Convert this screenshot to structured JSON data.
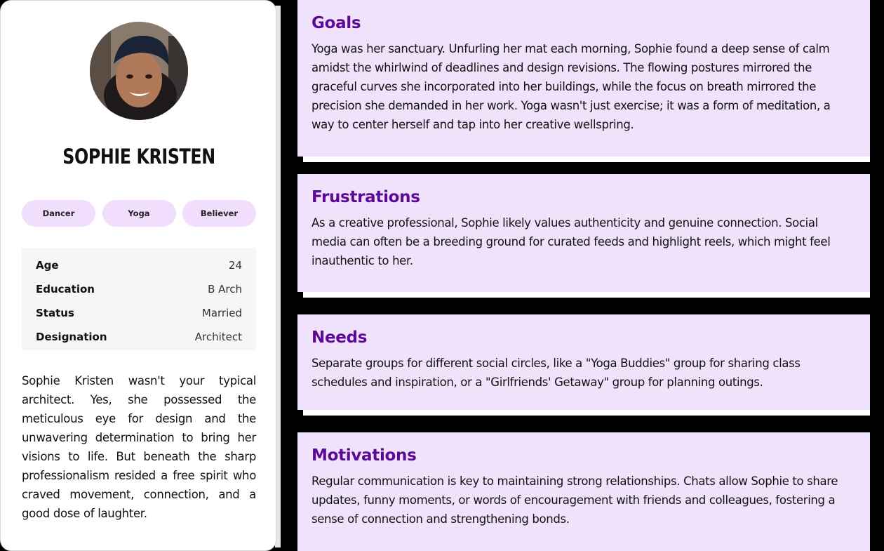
{
  "profile": {
    "name": "SOPHIE KRISTEN",
    "avatar": "profile-photo",
    "tags": [
      "Dancer",
      "Yoga",
      "Believer"
    ],
    "details": [
      {
        "label": "Age",
        "value": "24"
      },
      {
        "label": "Education",
        "value": "B Arch"
      },
      {
        "label": "Status",
        "value": "Married"
      },
      {
        "label": "Designation",
        "value": "Architect"
      }
    ],
    "bio": "Sophie Kristen wasn't your typical architect. Yes, she possessed the meticulous eye for design and the unwavering determination to bring her visions to life. But beneath the sharp professionalism resided a free spirit who craved movement, connection, and a good dose of laughter."
  },
  "sections": {
    "goals": {
      "title": "Goals",
      "body": "Yoga was her sanctuary. Unfurling her mat each morning, Sophie found a deep sense of calm amidst the whirlwind of deadlines and design revisions. The flowing postures mirrored the graceful curves she incorporated into her buildings, while the focus on breath mirrored the precision she demanded in her work. Yoga wasn't just exercise; it was a form of meditation, a way to center herself and tap into her creative wellspring."
    },
    "frustrations": {
      "title": "Frustrations",
      "body": "As a creative professional, Sophie likely values authenticity and genuine connection. Social media can often be a breeding ground for curated feeds and highlight reels, which might feel inauthentic to her."
    },
    "needs": {
      "title": "Needs",
      "body": "Separate groups for different social circles, like a \"Yoga Buddies\" group for sharing class schedules and inspiration, or a \"Girlfriends' Getaway\" group for planning outings."
    },
    "motivations": {
      "title": "Motivations",
      "body": "Regular communication is key to maintaining strong relationships. Chats allow Sophie to share updates, funny moments, or words of encouragement with friends and colleagues, fostering a sense of connection and strengthening bonds."
    }
  },
  "colors": {
    "accent": "#5c0996",
    "section_bg": "#f1e2fc",
    "tag_bg": "#f1ddfc"
  }
}
